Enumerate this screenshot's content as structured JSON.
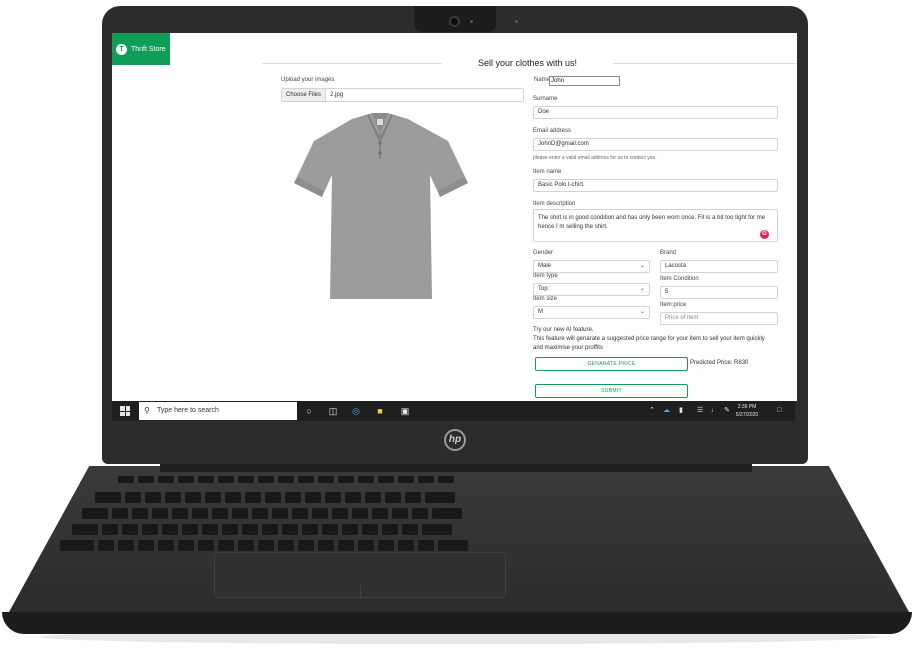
{
  "app": {
    "brand_initial": "T",
    "brand_name": "Thrift Store",
    "brand_color": "#0f9d58"
  },
  "page": {
    "title": "Sell your clothes with us!"
  },
  "upload": {
    "label": "Upload your images",
    "button": "Choose Files",
    "filename": "2.jpg"
  },
  "form": {
    "name_label": "Name",
    "name_value": "John",
    "surname_label": "Surname",
    "surname_value": "Doe",
    "email_label": "Email address",
    "email_value": "JohnD@gmail.com",
    "email_hint": "please enter a valid email address for us to contact you.",
    "item_name_label": "Item name",
    "item_name_value": "Basic Polo t-chirt.",
    "desc_label": "Item description",
    "desc_value": "The shirt is in good condition and has only been worn once. Fit is a bit too tight for me hence I m selling the shirt.",
    "gender_label": "Gender",
    "gender_value": "Male",
    "brand_label": "Brand",
    "brand_value": "Lacosta",
    "item_type_label": "Item type",
    "item_type_value": "Top",
    "condition_label": "Item Condition",
    "condition_value": "5",
    "size_label": "Item size",
    "size_value": "M",
    "price_label": "Item price",
    "price_placeholder": "Price of item"
  },
  "ai": {
    "line1": "Try our new AI feature.",
    "line2": "This feature will genarate a suggested price range for your item to sell your item quickly",
    "line3": "and maximise your proffits",
    "generate_button": "GENARATE PRICE",
    "predicted": "Predicted Price: R830",
    "submit_button": "SUBMIT"
  },
  "taskbar": {
    "search_placeholder": "Type here to search",
    "time": "2:39 PM",
    "date": "5/27/2020",
    "icons": [
      "start-icon",
      "search-icon",
      "cortana-icon",
      "task-view-icon",
      "edge-icon",
      "file-explorer-icon",
      "store-icon",
      "chevron-up-icon",
      "onedrive-icon",
      "battery-icon",
      "network-icon",
      "volume-icon",
      "pen-icon",
      "notification-icon"
    ]
  },
  "device": {
    "logo": "hp"
  }
}
